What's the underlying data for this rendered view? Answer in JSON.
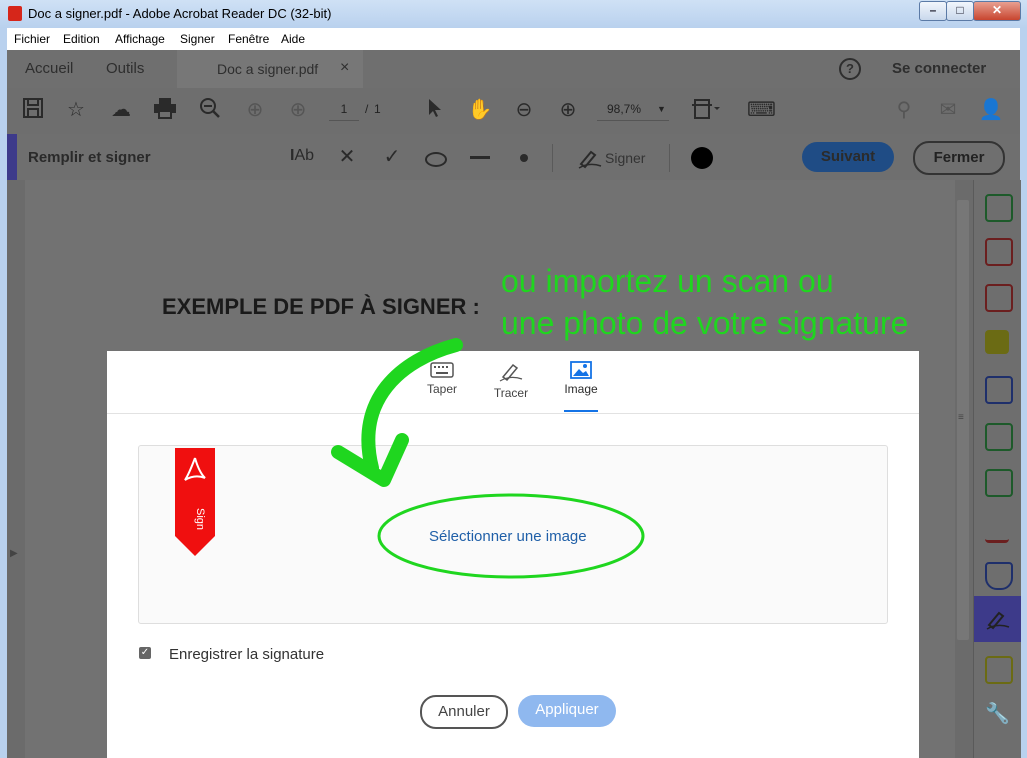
{
  "window": {
    "title": "Doc a signer.pdf - Adobe Acrobat Reader DC (32-bit)"
  },
  "menu": [
    "Fichier",
    "Edition",
    "Affichage",
    "Signer",
    "Fenêtre",
    "Aide"
  ],
  "tabs": {
    "home": "Accueil",
    "tools": "Outils",
    "doc": "Doc a signer.pdf",
    "close": "×",
    "signin": "Se connecter",
    "help": "?"
  },
  "toolbar": {
    "page_current": "1",
    "page_sep": "/",
    "page_total": "1",
    "zoom": "98,7%"
  },
  "fill_sign": {
    "title": "Remplir et signer",
    "text_tool": "Ab",
    "sign_label": "Signer",
    "next_label": "Suivant",
    "close_label": "Fermer"
  },
  "document": {
    "heading": "EXEMPLE DE PDF À SIGNER :"
  },
  "dialog": {
    "tabs": [
      "Taper",
      "Tracer",
      "Image"
    ],
    "select_image": "Sélectionner une image",
    "save_signature": "Enregistrer la signature",
    "cancel": "Annuler",
    "apply": "Appliquer",
    "stamp_text": "Sign"
  },
  "annotation": {
    "line1": "ou importez un scan ou",
    "line2": "une photo de votre signature"
  },
  "colors": {
    "accent": "#3d3a8a",
    "primary_blue": "#1473e6",
    "annotation_green": "#1fd61f",
    "stamp_red": "#f00f0f"
  }
}
